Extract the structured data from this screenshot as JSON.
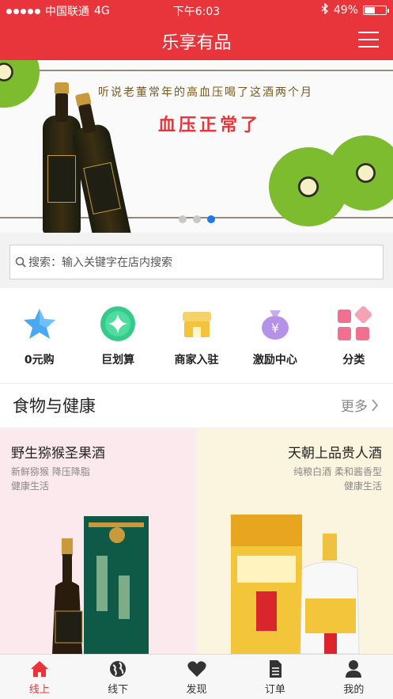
{
  "status": {
    "carrier": "中国联通",
    "network": "4G",
    "time": "下午6:03",
    "battery": "49%"
  },
  "header": {
    "title": "乐享有品"
  },
  "banner": {
    "headline": "听说老董常年的高血压喝了这酒两个月",
    "tagline": "血压正常了",
    "pages": 3,
    "active_page": 3
  },
  "search": {
    "placeholder": "搜索：输入关键字在店内搜索"
  },
  "categories": [
    {
      "label": "0元购",
      "icon": "star-icon",
      "color": "#4aa8f0"
    },
    {
      "label": "巨划算",
      "icon": "diamond-icon",
      "color": "#35c98a"
    },
    {
      "label": "商家入驻",
      "icon": "shop-icon",
      "color": "#f3c33b"
    },
    {
      "label": "激励中心",
      "icon": "money-bag-icon",
      "color": "#b592e8"
    },
    {
      "label": "分类",
      "icon": "grid-icon",
      "color": "#f2708f"
    }
  ],
  "section": {
    "title": "食物与健康",
    "more": "更多"
  },
  "products": [
    {
      "title": "野生猕猴圣果酒",
      "line1": "新鲜猕猴 降压降脂",
      "line2": "健康生活"
    },
    {
      "title": "天朝上品贵人酒",
      "line1": "纯粮白酒 柔和酱香型",
      "line2": "健康生活"
    }
  ],
  "tabbar": [
    {
      "label": "线上",
      "icon": "home-icon"
    },
    {
      "label": "线下",
      "icon": "globe-icon"
    },
    {
      "label": "发现",
      "icon": "heart-icon"
    },
    {
      "label": "订单",
      "icon": "document-icon"
    },
    {
      "label": "我的",
      "icon": "user-icon"
    }
  ],
  "colors": {
    "primary": "#e8343b",
    "pager_active": "#1f7ae6"
  }
}
